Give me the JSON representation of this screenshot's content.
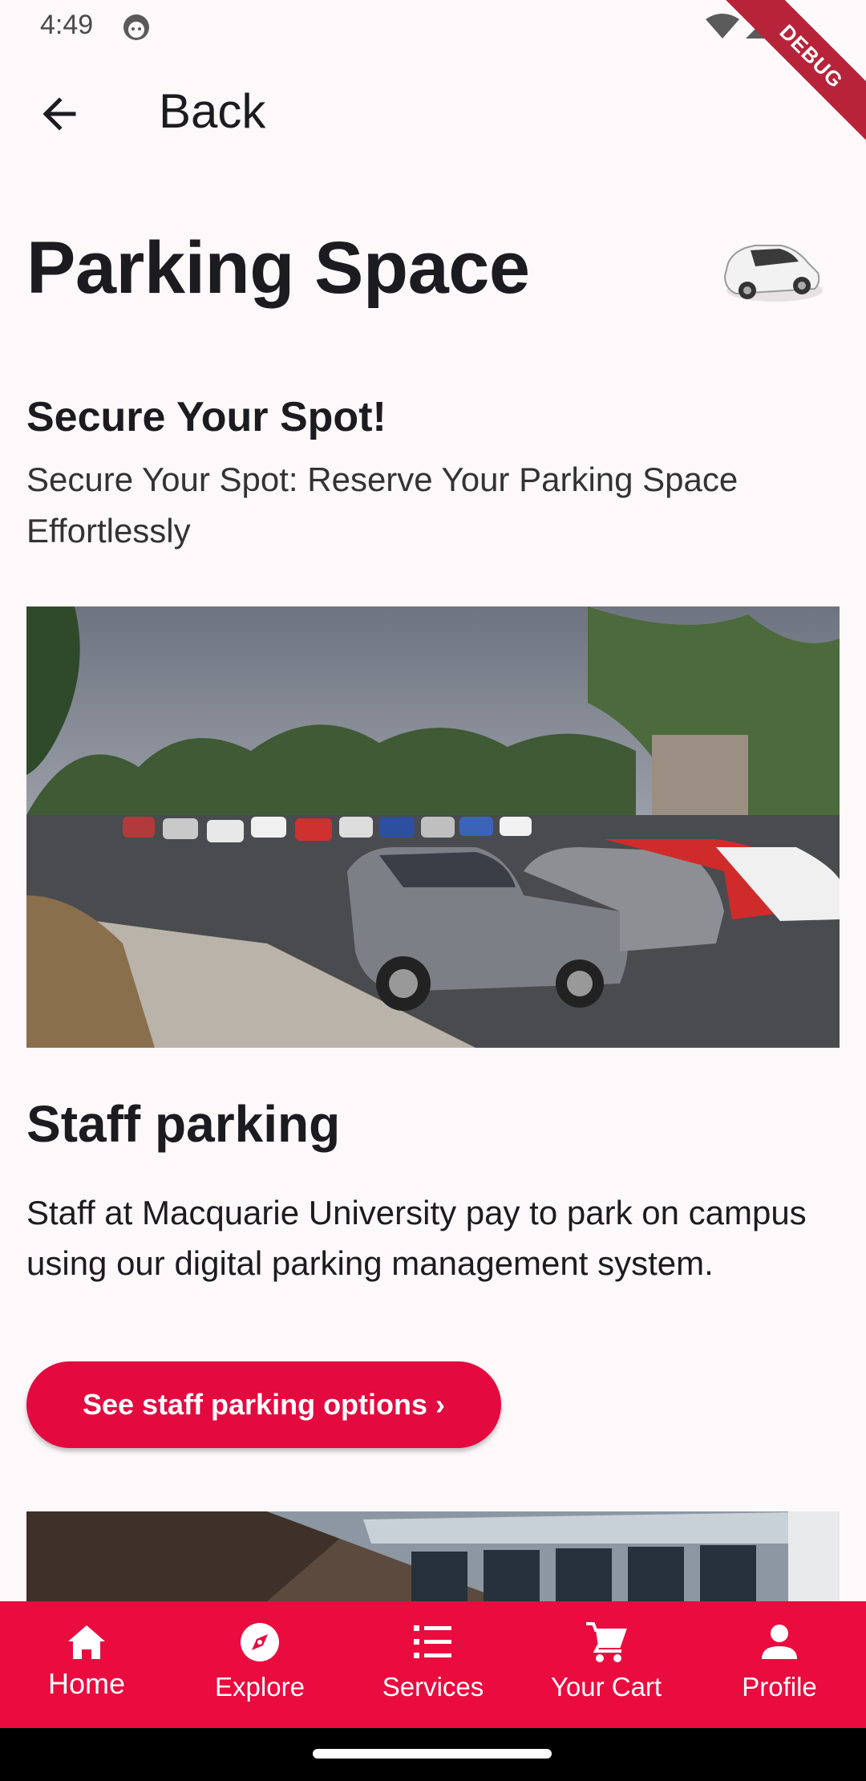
{
  "status_bar": {
    "time": "4:49",
    "debug_label": "DEBUG"
  },
  "app_bar": {
    "back_label": "Back"
  },
  "page": {
    "title": "Parking Space",
    "section_title": "Secure Your Spot!",
    "section_subtitle": "Secure Your Spot: Reserve Your Parking Space Effortlessly",
    "staff_title": "Staff parking",
    "staff_description": "Staff at Macquarie University pay to  park on campus using our  digital parking management system.",
    "staff_button_label": "See staff parking options ›"
  },
  "bottom_nav": {
    "items": [
      {
        "label": "Home",
        "icon": "home-icon",
        "active": true
      },
      {
        "label": "Explore",
        "icon": "compass-icon"
      },
      {
        "label": "Services",
        "icon": "list-icon"
      },
      {
        "label": "Your Cart",
        "icon": "cart-icon"
      },
      {
        "label": "Profile",
        "icon": "person-icon"
      }
    ]
  },
  "colors": {
    "accent": "#e4093f",
    "nav_background": "#ea0b3f",
    "background": "#fdf8fa"
  }
}
